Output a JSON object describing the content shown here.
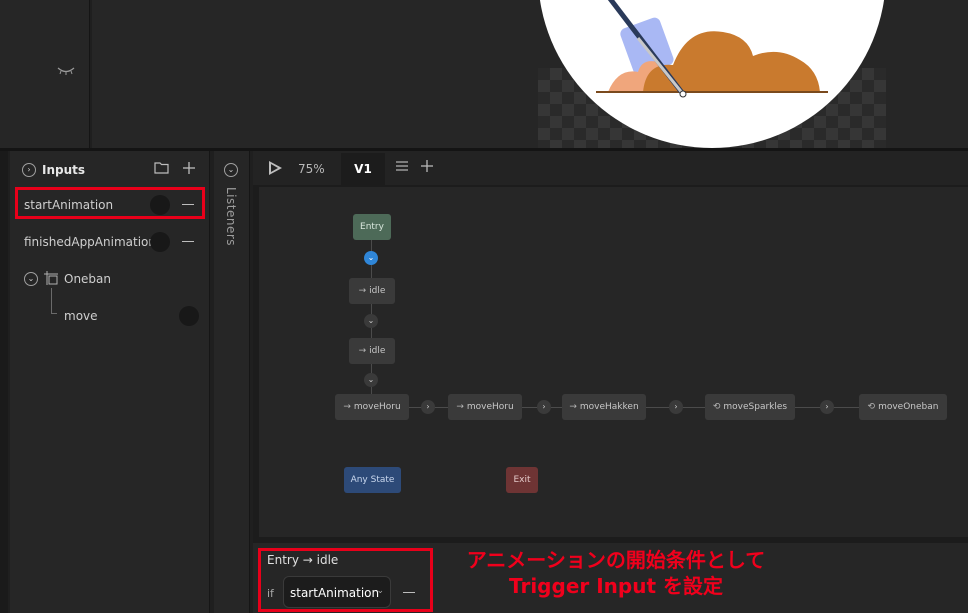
{
  "colors": {
    "highlight": "#e8001a",
    "annotation_text": "#f0001c",
    "entry_node": "#4d6a58",
    "any_state_node": "#2d4a78",
    "exit_node": "#6e3434",
    "active_connector": "#2f86d8"
  },
  "inputs_panel": {
    "title": "Inputs",
    "items": [
      {
        "label": "startAnimation",
        "highlighted": true
      },
      {
        "label": "finishedAppAnimation"
      }
    ],
    "nested_artboard": {
      "label": "Oneban",
      "child": "move"
    }
  },
  "listeners": {
    "label": "Listeners"
  },
  "toolbar": {
    "zoom": "75%",
    "active_tab": "V1"
  },
  "graph": {
    "entry": "Entry",
    "states_vertical": [
      "idle",
      "idle"
    ],
    "states_row": [
      {
        "label": "moveHoru",
        "icon": "arrow-right"
      },
      {
        "label": "moveHoru",
        "icon": "arrow-right"
      },
      {
        "label": "moveHakken",
        "icon": "arrow-right"
      },
      {
        "label": "moveSparkles",
        "icon": "loop"
      },
      {
        "label": "moveOneban",
        "icon": "loop"
      }
    ],
    "any_state": "Any State",
    "exit": "Exit"
  },
  "transition": {
    "title": "Entry → idle",
    "if_label": "if",
    "condition_input": "startAnimation"
  },
  "annotation": {
    "line1": "アニメーションの開始条件として",
    "line2": "Trigger Input を設定"
  }
}
